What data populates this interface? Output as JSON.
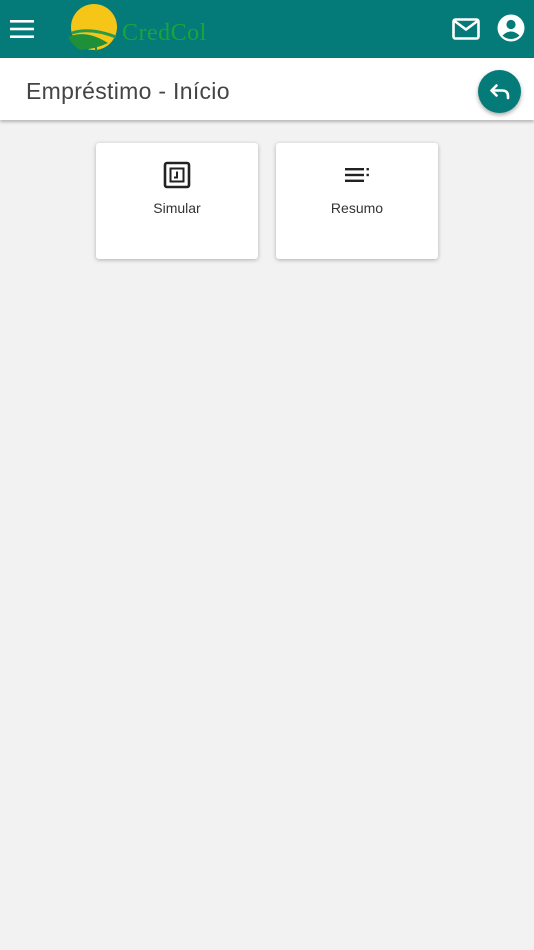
{
  "app": {
    "brand_name": "CredCol",
    "colors": {
      "primary": "#047b78",
      "logo_green": "#18a53a",
      "logo_sun": "#f5c518",
      "background": "#f2f2f2"
    }
  },
  "topbar": {
    "menu_icon": "hamburger-menu-icon",
    "mail_icon": "mail-icon",
    "account_icon": "account-circle-icon"
  },
  "header": {
    "title": "Empréstimo - Início",
    "back_icon": "undo-icon"
  },
  "cards": [
    {
      "label": "Simular",
      "icon": "simulate-icon"
    },
    {
      "label": "Resumo",
      "icon": "list-summary-icon"
    }
  ]
}
